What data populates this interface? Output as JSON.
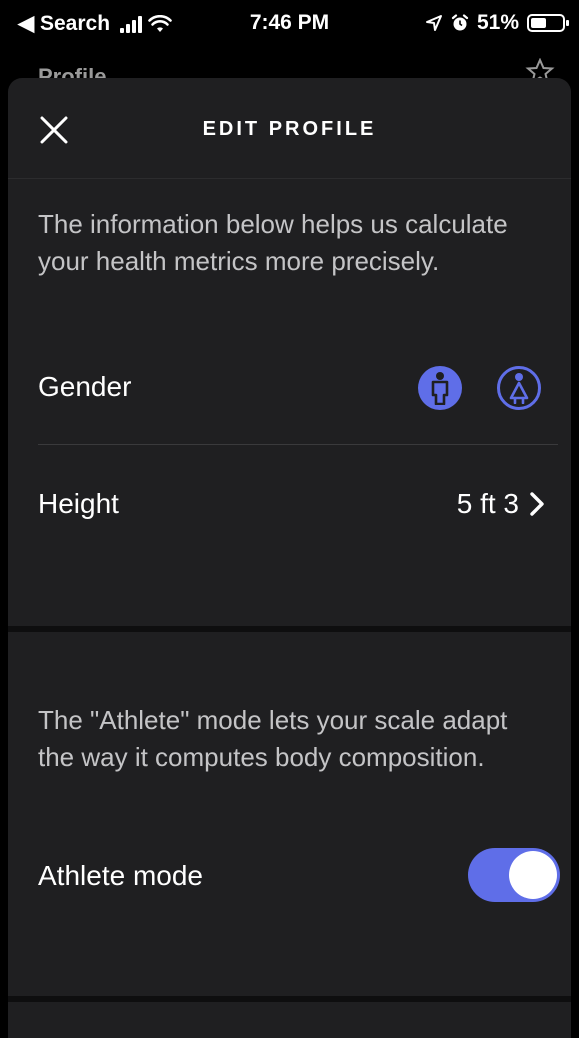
{
  "status_bar": {
    "back_label": "◀ Search",
    "time": "7:46 PM",
    "battery": "51%",
    "battery_level": 0.51
  },
  "background": {
    "title": "Profile",
    "icon": "star-icon"
  },
  "header": {
    "title": "EDIT PROFILE",
    "close_icon": "close-icon"
  },
  "health_section": {
    "description": "The information below helps us calculate your health metrics more precisely.",
    "gender_label": "Gender",
    "gender_options": [
      {
        "icon": "male-icon",
        "selected": true
      },
      {
        "icon": "female-icon",
        "selected": false
      }
    ],
    "height_label": "Height",
    "height_value": "5 ft 3"
  },
  "athlete_section": {
    "description": "The \"Athlete\" mode lets your scale adapt the way it computes body composition.",
    "toggle_label": "Athlete mode",
    "toggle_on": true
  },
  "colors": {
    "accent": "#5f6ee8",
    "sheet": "#1f1f21",
    "text_secondary": "#c4c4c6"
  }
}
